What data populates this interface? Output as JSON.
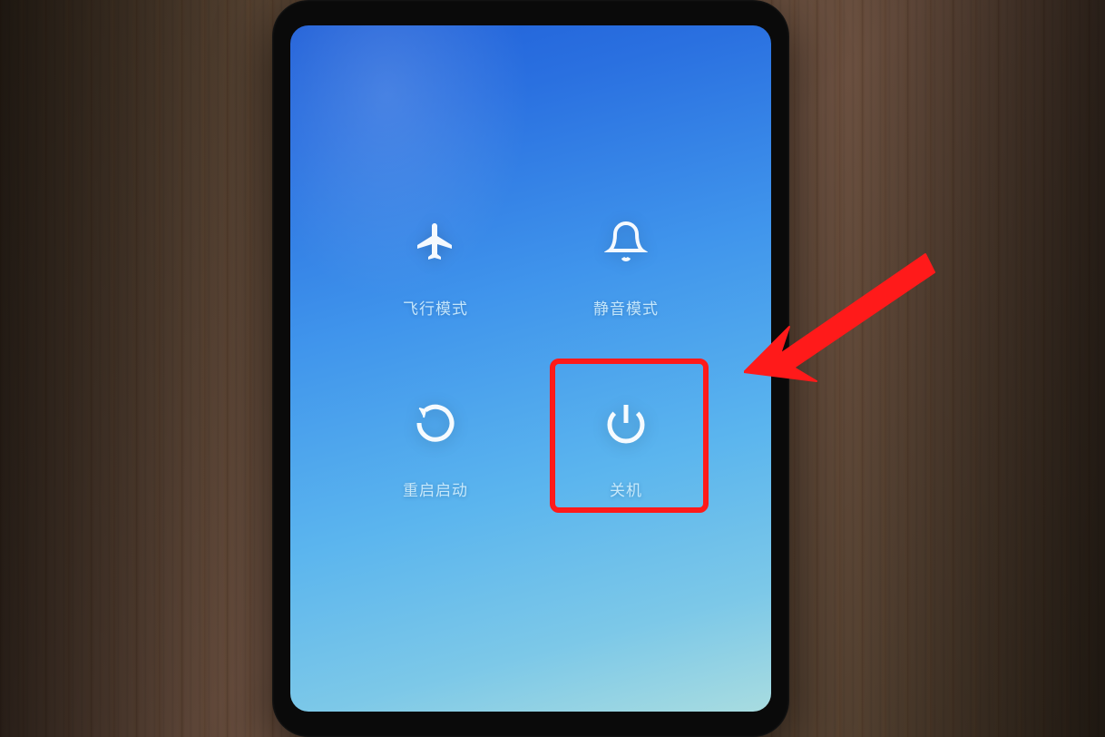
{
  "power_menu": {
    "items": [
      {
        "id": "airplane-mode",
        "label": "飞行模式"
      },
      {
        "id": "silent-mode",
        "label": "静音模式"
      },
      {
        "id": "restart",
        "label": "重启启动"
      },
      {
        "id": "power-off",
        "label": "关机"
      }
    ]
  },
  "annotation": {
    "highlighted_item": "power-off",
    "arrow_color": "#ff1a1a",
    "box_color": "#ff1a1a"
  }
}
